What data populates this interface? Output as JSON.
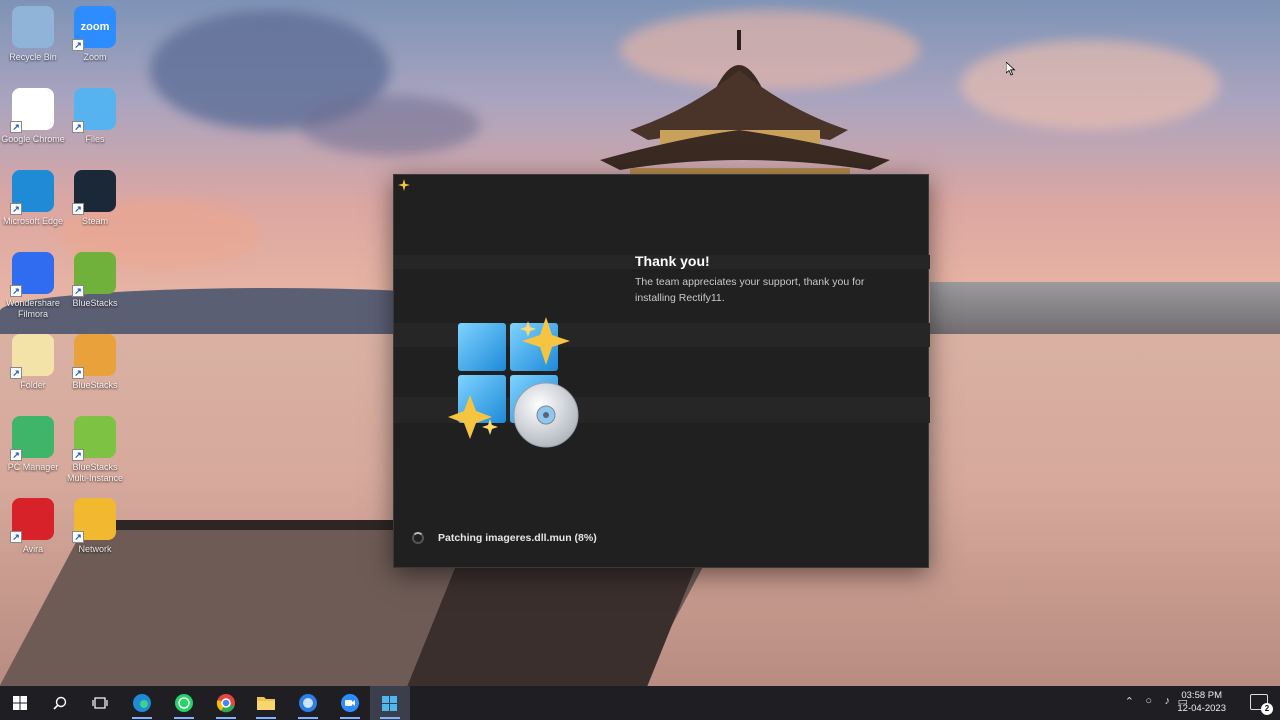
{
  "desktop": {
    "icons": [
      {
        "label": "Recycle Bin",
        "glyph": "",
        "color": "#8fb4d8"
      },
      {
        "label": "Zoom",
        "glyph": "zoom",
        "color": "#2d8cff"
      },
      {
        "label": "Google Chrome",
        "glyph": "",
        "color": "#ffffff"
      },
      {
        "label": "Files",
        "glyph": "",
        "color": "#56b3f0"
      },
      {
        "label": "Microsoft Edge",
        "glyph": "",
        "color": "#1f8ad6"
      },
      {
        "label": "Steam",
        "glyph": "",
        "color": "#1b2838"
      },
      {
        "label": "Wondershare Filmora",
        "glyph": "",
        "color": "#2f6cf0"
      },
      {
        "label": "BlueStacks",
        "glyph": "",
        "color": "#6fb13a"
      },
      {
        "label": "Folder",
        "glyph": "",
        "color": "#f3e3a8"
      },
      {
        "label": "BlueStacks",
        "glyph": "",
        "color": "#e9a13b"
      },
      {
        "label": "PC Manager",
        "glyph": "",
        "color": "#3fb56a"
      },
      {
        "label": "BlueStacks Multi-Instance",
        "glyph": "",
        "color": "#7dc243"
      },
      {
        "label": "Avira",
        "glyph": "",
        "color": "#d8222a"
      },
      {
        "label": "Network",
        "glyph": "",
        "color": "#f2b830"
      }
    ]
  },
  "installer": {
    "heading": "Thank you!",
    "message": "The team appreciates your support, thank you for installing Rectify11.",
    "status": "Patching imageres.dll.mun (8%)",
    "progress_percent": 8,
    "accent_colors": {
      "tile": "#3fb3ee",
      "sparkle": "#f5c542",
      "disc": "#d9dde2"
    }
  },
  "taskbar": {
    "apps": [
      {
        "name": "start-button",
        "icon": "windows-logo-icon"
      },
      {
        "name": "search-button",
        "icon": "search-icon"
      },
      {
        "name": "task-view-button",
        "icon": "task-view-icon"
      },
      {
        "name": "edge-taskbar",
        "icon": "edge-icon"
      },
      {
        "name": "whatsapp-taskbar",
        "icon": "whatsapp-icon"
      },
      {
        "name": "chrome-taskbar",
        "icon": "chrome-icon"
      },
      {
        "name": "file-explorer-taskbar",
        "icon": "folder-icon"
      },
      {
        "name": "browser-taskbar",
        "icon": "browser-icon"
      },
      {
        "name": "zoom-taskbar",
        "icon": "zoom-icon"
      },
      {
        "name": "installer-taskbar",
        "icon": "installer-icon"
      }
    ],
    "clock_time": "03:58 PM",
    "clock_date": "12-04-2023",
    "notification_count": "2"
  }
}
